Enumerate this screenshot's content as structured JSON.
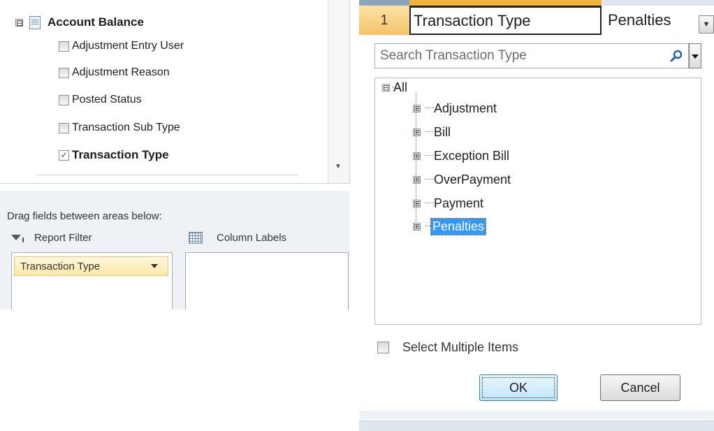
{
  "field_list": {
    "group": {
      "label": "Account Balance",
      "collapse_symbol": "⊟",
      "icon": "table-icon"
    },
    "fields": [
      {
        "label": "Adjustment Entry User",
        "checked": false
      },
      {
        "label": "Adjustment Reason",
        "checked": false
      },
      {
        "label": "Posted Status",
        "checked": false
      },
      {
        "label": "Transaction Sub Type",
        "checked": false
      },
      {
        "label": "Transaction Type",
        "checked": true
      }
    ],
    "checkmark": "✓"
  },
  "areas": {
    "title": "Drag fields between areas below:",
    "report_filter": {
      "label": "Report Filter",
      "icon": "filter-icon",
      "chip": "Transaction Type"
    },
    "column_labels": {
      "label": "Column Labels",
      "icon": "grid-icon"
    }
  },
  "sheet": {
    "row_number": "1",
    "cell_a": "Transaction Type",
    "cell_b": "Penalties",
    "filter_button_symbol": "▼"
  },
  "filter_popup": {
    "search_placeholder": "Search Transaction Type",
    "tree": {
      "root": {
        "label": "All",
        "symbol": "⊟"
      },
      "items": [
        {
          "label": "Adjustment",
          "symbol": "⊞",
          "selected": false
        },
        {
          "label": "Bill",
          "symbol": "⊞",
          "selected": false
        },
        {
          "label": "Exception Bill",
          "symbol": "⊞",
          "selected": false
        },
        {
          "label": "OverPayment",
          "symbol": "⊞",
          "selected": false
        },
        {
          "label": "Payment",
          "symbol": "⊞",
          "selected": false
        },
        {
          "label": "Penalties",
          "symbol": "⊞",
          "selected": true
        }
      ]
    },
    "select_multiple_label": "Select Multiple Items",
    "ok_label": "OK",
    "cancel_label": "Cancel"
  },
  "colors": {
    "selection": "#3399ff",
    "chip_border": "#e4c670",
    "row_header": "#f4c36b"
  }
}
